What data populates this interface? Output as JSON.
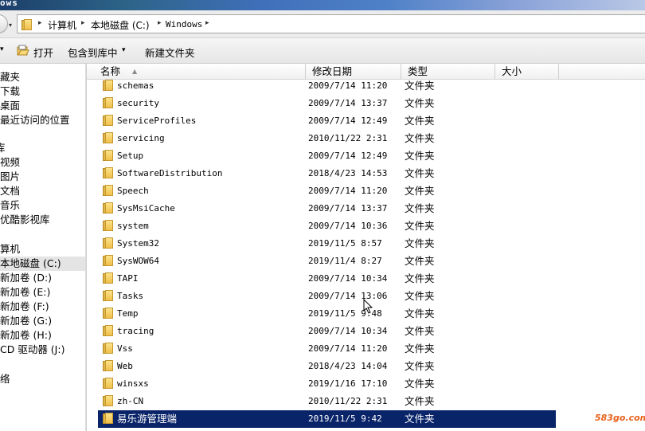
{
  "window": {
    "title_fragment": "ows"
  },
  "address": {
    "crumbs": [
      "计算机",
      "本地磁盘 (C:)",
      "Windows"
    ]
  },
  "toolbar": {
    "open_label": "打开",
    "include_label": "包含到库中",
    "include_arrow": "▾",
    "new_folder_label": "新建文件夹"
  },
  "nav": {
    "items": [
      {
        "label": "收藏夹",
        "shown": "藏夹"
      },
      {
        "label": "下载"
      },
      {
        "label": "桌面"
      },
      {
        "label": "最近访问的位置"
      },
      {
        "label": "库",
        "shown": "库"
      },
      {
        "label": "视频"
      },
      {
        "label": "图片"
      },
      {
        "label": "文档"
      },
      {
        "label": "音乐"
      },
      {
        "label": "优酷影视库"
      },
      {
        "label": "计算机",
        "shown": "算机"
      },
      {
        "label": "本地磁盘 (C:)"
      },
      {
        "label": "新加卷 (D:)"
      },
      {
        "label": "新加卷 (E:)"
      },
      {
        "label": "新加卷 (F:)"
      },
      {
        "label": "新加卷 (G:)"
      },
      {
        "label": "新加卷 (H:)"
      },
      {
        "label": "CD 驱动器 (J:)"
      },
      {
        "label": "网络",
        "shown": "络"
      }
    ]
  },
  "columns": {
    "name": "名称",
    "date": "修改日期",
    "type": "类型",
    "size": "大小"
  },
  "files": [
    {
      "name": "schemas",
      "date": "2009/7/14 11:20",
      "type": "文件夹"
    },
    {
      "name": "security",
      "date": "2009/7/14 13:37",
      "type": "文件夹"
    },
    {
      "name": "ServiceProfiles",
      "date": "2009/7/14 12:49",
      "type": "文件夹"
    },
    {
      "name": "servicing",
      "date": "2010/11/22 2:31",
      "type": "文件夹"
    },
    {
      "name": "Setup",
      "date": "2009/7/14 12:49",
      "type": "文件夹"
    },
    {
      "name": "SoftwareDistribution",
      "date": "2018/4/23 14:53",
      "type": "文件夹"
    },
    {
      "name": "Speech",
      "date": "2009/7/14 11:20",
      "type": "文件夹"
    },
    {
      "name": "SysMsiCache",
      "date": "2009/7/14 13:37",
      "type": "文件夹"
    },
    {
      "name": "system",
      "date": "2009/7/14 10:36",
      "type": "文件夹"
    },
    {
      "name": "System32",
      "date": "2019/11/5 8:57",
      "type": "文件夹"
    },
    {
      "name": "SysWOW64",
      "date": "2019/11/4 8:27",
      "type": "文件夹"
    },
    {
      "name": "TAPI",
      "date": "2009/7/14 10:34",
      "type": "文件夹"
    },
    {
      "name": "Tasks",
      "date": "2009/7/14 13:06",
      "type": "文件夹"
    },
    {
      "name": "Temp",
      "date": "2019/11/5 9:48",
      "type": "文件夹"
    },
    {
      "name": "tracing",
      "date": "2009/7/14 10:34",
      "type": "文件夹"
    },
    {
      "name": "Vss",
      "date": "2009/7/14 11:20",
      "type": "文件夹"
    },
    {
      "name": "Web",
      "date": "2018/4/23 14:04",
      "type": "文件夹"
    },
    {
      "name": "winsxs",
      "date": "2019/1/16 17:10",
      "type": "文件夹"
    },
    {
      "name": "zh-CN",
      "date": "2010/11/22 2:31",
      "type": "文件夹"
    },
    {
      "name": "易乐游管理端",
      "date": "2019/11/5 9:42",
      "type": "文件夹",
      "selected": true
    }
  ],
  "watermark": "583go.com",
  "colors": {
    "selection": "#0a246a",
    "watermark": "#e8611a"
  }
}
